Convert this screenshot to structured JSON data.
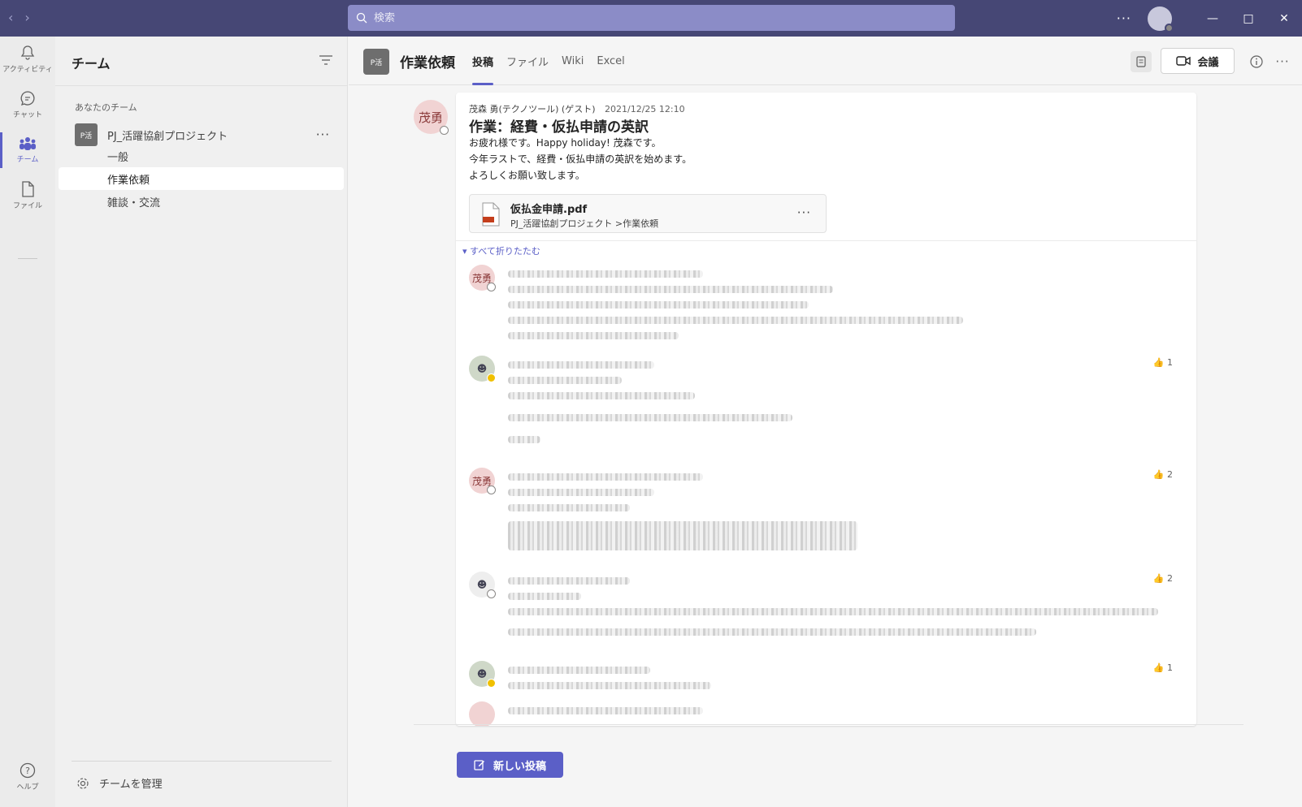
{
  "search": {
    "placeholder": "検索"
  },
  "rail": {
    "items": [
      {
        "label": "アクティビティ",
        "icon": "bell-icon"
      },
      {
        "label": "チャット",
        "icon": "chat-icon"
      },
      {
        "label": "チーム",
        "icon": "teams-icon"
      },
      {
        "label": "ファイル",
        "icon": "file-icon"
      }
    ],
    "help": "ヘルプ"
  },
  "sidebar": {
    "title": "チーム",
    "section": "あなたのチーム",
    "team": {
      "tile": "P活",
      "name": "PJ_活躍協創プロジェクト"
    },
    "channels": [
      "一般",
      "作業依頼",
      "雑談・交流"
    ],
    "manage": "チームを管理"
  },
  "channel": {
    "tile": "P活",
    "title": "作業依頼",
    "tabs": [
      "投稿",
      "ファイル",
      "Wiki",
      "Excel"
    ],
    "meet": "会議"
  },
  "post": {
    "avatar": "茂勇",
    "author": "茂森 勇(テクノツール) (ゲスト)",
    "time": "2021/12/25 12:10",
    "title": "作業：経費・仮払申請の英訳",
    "body": [
      "お疲れ様です。Happy holiday! 茂森です。",
      "今年ラストで、経費・仮払申請の英訳を始めます。",
      "よろしくお願い致します。"
    ],
    "attachment": {
      "name": "仮払金申請.pdf",
      "path": "PJ_活躍協創プロジェクト >作業依頼"
    },
    "collapse": "すべて折りたたむ"
  },
  "replies": [
    {
      "avatar": "茂勇",
      "reaction": ""
    },
    {
      "avatar": "",
      "reaction": "1"
    },
    {
      "avatar": "茂勇",
      "reaction": "2"
    },
    {
      "avatar": "",
      "reaction": "2"
    },
    {
      "avatar": "",
      "reaction": "1"
    }
  ],
  "new_post": "新しい投稿",
  "colors": {
    "accent": "#5b5fc7",
    "titlebar": "#464775"
  }
}
